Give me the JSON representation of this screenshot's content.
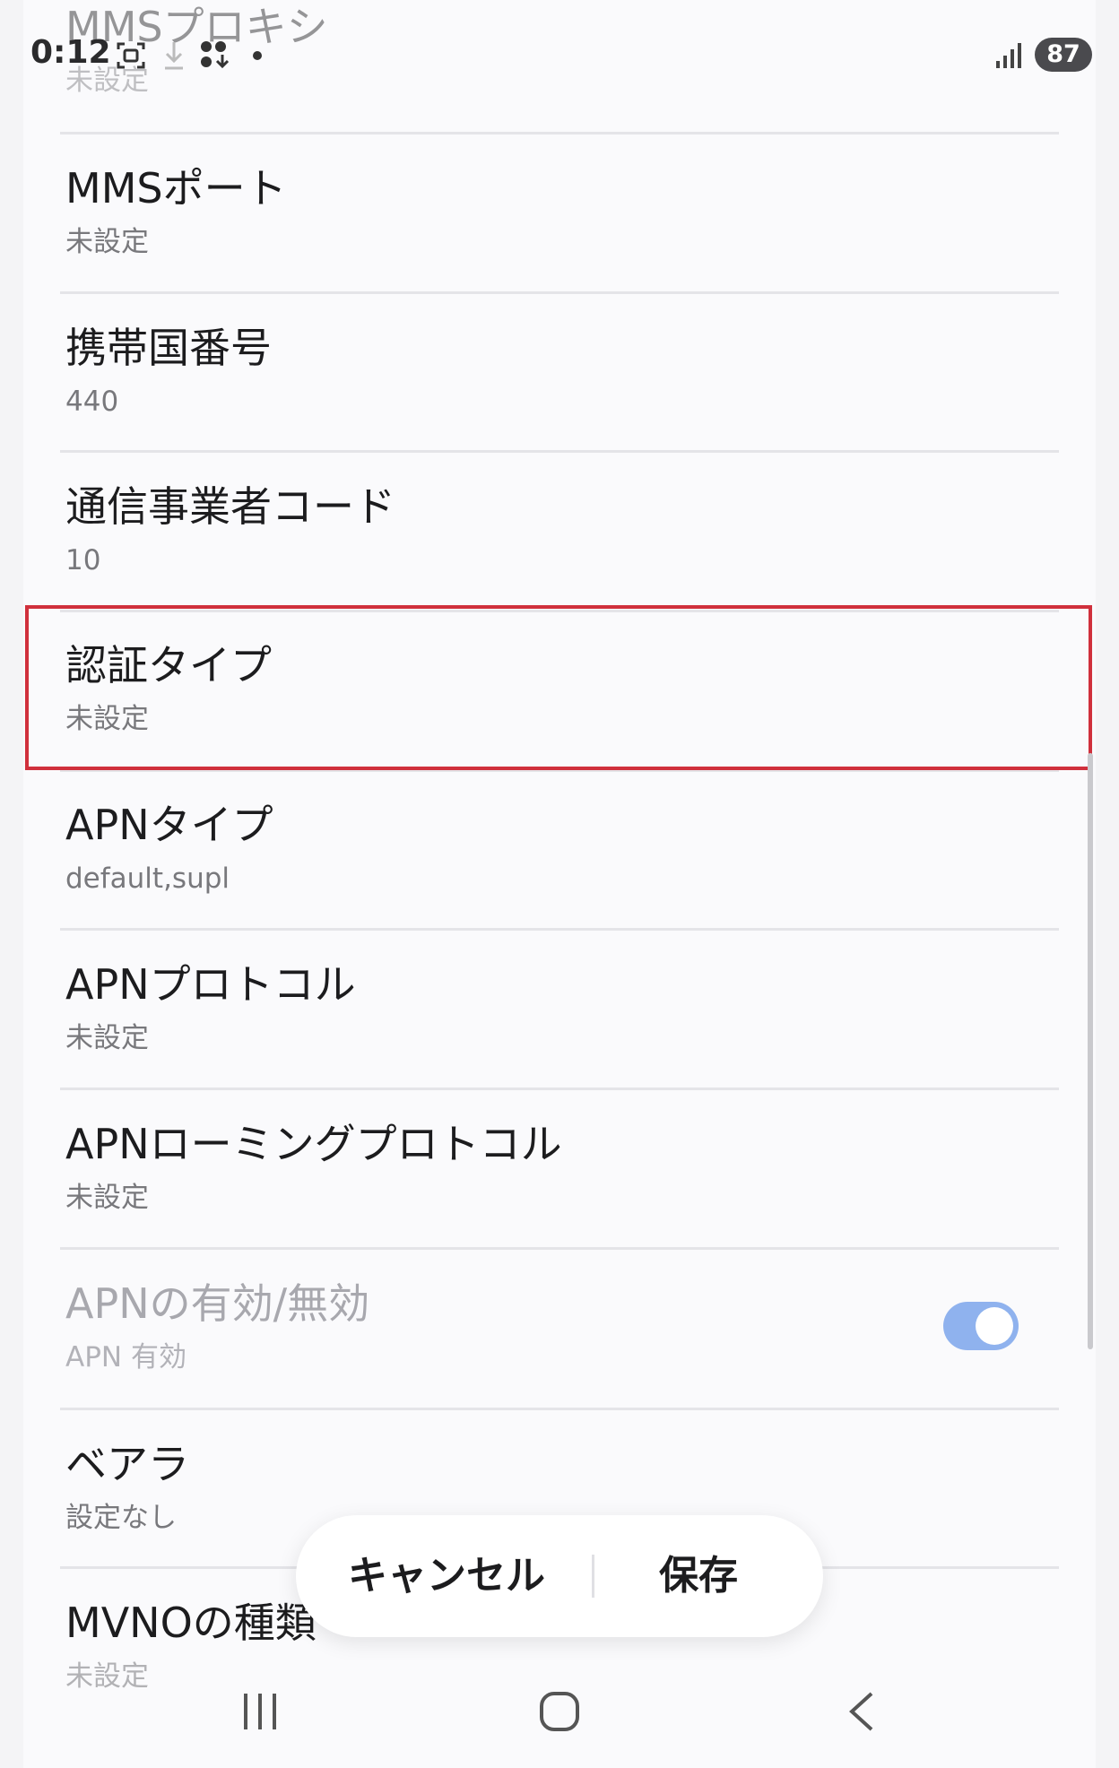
{
  "status_bar": {
    "time": "0:12",
    "battery": "87",
    "icons": [
      "screenshot-icon",
      "download-icon",
      "apps-download-icon",
      "dot-icon",
      "signal-icon"
    ]
  },
  "settings": {
    "rows": [
      {
        "title": "MMSプロキシ",
        "value": "未設定"
      },
      {
        "title": "MMSポート",
        "value": "未設定"
      },
      {
        "title": "携帯国番号",
        "value": "440"
      },
      {
        "title": "通信事業者コード",
        "value": "10"
      },
      {
        "title": "認証タイプ",
        "value": "未設定"
      },
      {
        "title": "APNタイプ",
        "value": "default,supl"
      },
      {
        "title": "APNプロトコル",
        "value": "未設定"
      },
      {
        "title": "APNローミングプロトコル",
        "value": "未設定"
      },
      {
        "title": "APNの有効/無効",
        "value": "APN 有効"
      },
      {
        "title": "ベアラ",
        "value": "設定なし"
      },
      {
        "title": "MVNOの種類",
        "value": "未設定"
      }
    ],
    "apn_enabled": true
  },
  "actions": {
    "cancel_label": "キャンセル",
    "save_label": "保存"
  },
  "colors": {
    "highlight": "#d0303c",
    "toggle_on": "#8fb2ee"
  }
}
